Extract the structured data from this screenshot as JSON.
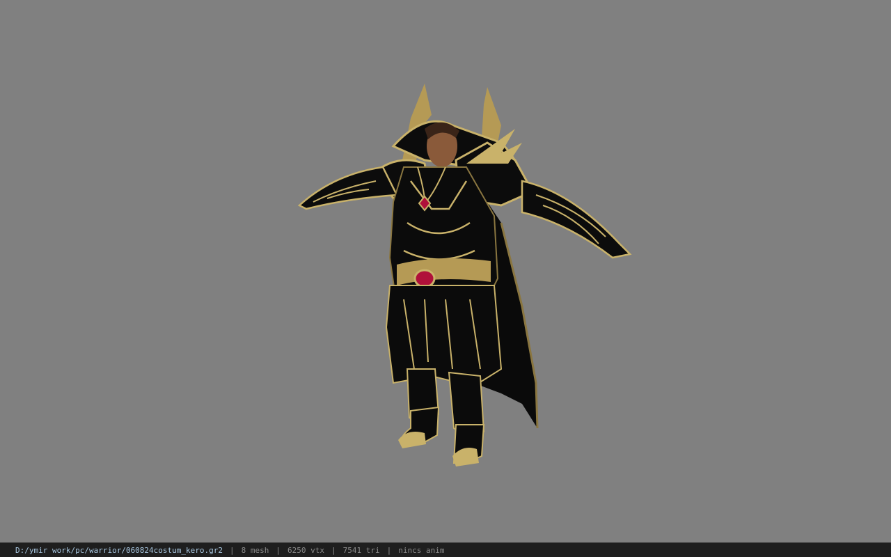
{
  "viewport": {
    "background": "#808080",
    "model": {
      "icon": "armored-character-model",
      "colors": {
        "armor": "#0b0b0b",
        "trim": "#c9b26a",
        "trim_dark": "#8a7640",
        "skin": "#8a5a3a",
        "hair": "#3a2418",
        "gem": "#b0103a"
      }
    }
  },
  "statusbar": {
    "file_path": "D:/ymir work/pc/warrior/060824costum_kero.gr2",
    "separator": "|",
    "mesh": "8 mesh",
    "vertices": "6250 vtx",
    "triangles": "7541 tri",
    "anim": "nincs anim"
  }
}
